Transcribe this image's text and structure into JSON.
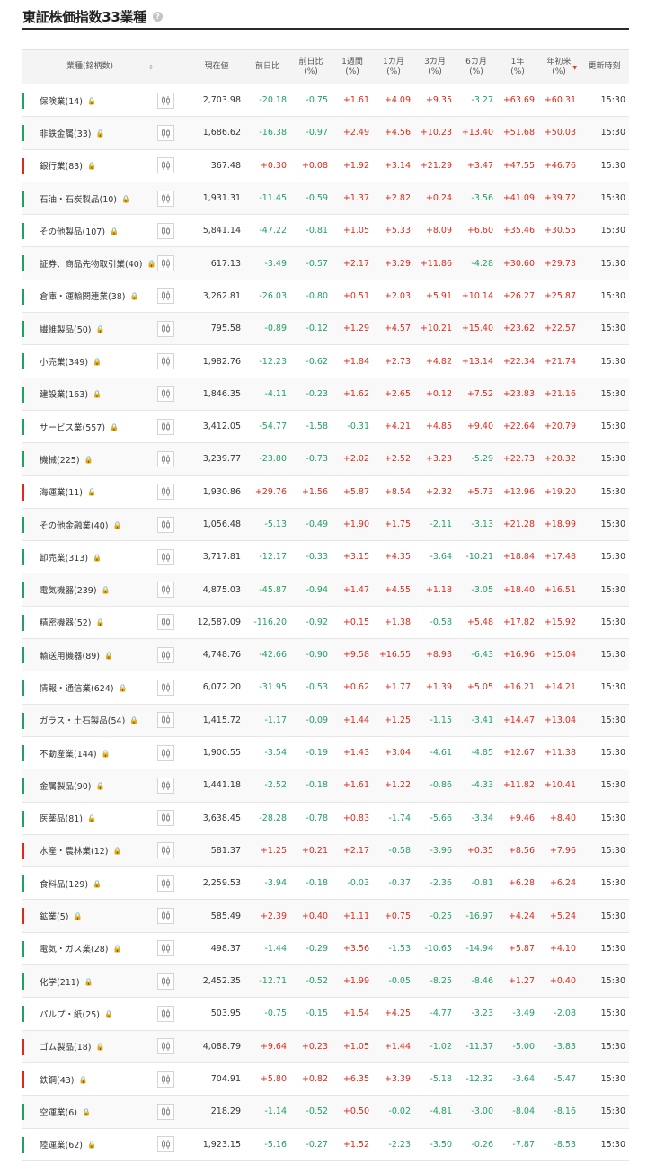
{
  "page_title": "東証株価指数33業種",
  "help_icon": "question-circle-icon",
  "lock_icon": "lock-icon",
  "chart_icon": "candlestick-chart-icon",
  "colors": {
    "up": "#e0281a",
    "down": "#20a162",
    "neutral": "#333333"
  },
  "columns": {
    "name": "業種(銘柄数)",
    "price": "現在値",
    "change": "前日比",
    "change_pct": "前日比\n(%)",
    "w1": "1週間\n(%)",
    "m1": "1カ月\n(%)",
    "m3": "3カ月\n(%)",
    "m6": "6カ月\n(%)",
    "y1": "1年\n(%)",
    "ytd": "年初来\n(%)",
    "time": "更新時刻"
  },
  "sort_icon": "↕",
  "sorted_desc_icon": "▼",
  "rows": [
    {
      "name": "保険業(14)",
      "price": "2,703.98",
      "change": "-20.18",
      "change_pct": "-0.75",
      "w1": "+1.61",
      "m1": "+4.09",
      "m3": "+9.35",
      "m6": "-3.27",
      "y1": "+63.69",
      "ytd": "+60.31",
      "time": "15:30"
    },
    {
      "name": "非鉄金属(33)",
      "price": "1,686.62",
      "change": "-16.38",
      "change_pct": "-0.97",
      "w1": "+2.49",
      "m1": "+4.56",
      "m3": "+10.23",
      "m6": "+13.40",
      "y1": "+51.68",
      "ytd": "+50.03",
      "time": "15:30"
    },
    {
      "name": "銀行業(83)",
      "price": "367.48",
      "change": "+0.30",
      "change_pct": "+0.08",
      "w1": "+1.92",
      "m1": "+3.14",
      "m3": "+21.29",
      "m6": "+3.47",
      "y1": "+47.55",
      "ytd": "+46.76",
      "time": "15:30"
    },
    {
      "name": "石油・石炭製品(10)",
      "price": "1,931.31",
      "change": "-11.45",
      "change_pct": "-0.59",
      "w1": "+1.37",
      "m1": "+2.82",
      "m3": "+0.24",
      "m6": "-3.56",
      "y1": "+41.09",
      "ytd": "+39.72",
      "time": "15:30"
    },
    {
      "name": "その他製品(107)",
      "price": "5,841.14",
      "change": "-47.22",
      "change_pct": "-0.81",
      "w1": "+1.05",
      "m1": "+5.33",
      "m3": "+8.09",
      "m6": "+6.60",
      "y1": "+35.46",
      "ytd": "+30.55",
      "time": "15:30"
    },
    {
      "name": "証券、商品先物取引業(40)",
      "price": "617.13",
      "change": "-3.49",
      "change_pct": "-0.57",
      "w1": "+2.17",
      "m1": "+3.29",
      "m3": "+11.86",
      "m6": "-4.28",
      "y1": "+30.60",
      "ytd": "+29.73",
      "time": "15:30"
    },
    {
      "name": "倉庫・運輸関連業(38)",
      "price": "3,262.81",
      "change": "-26.03",
      "change_pct": "-0.80",
      "w1": "+0.51",
      "m1": "+2.03",
      "m3": "+5.91",
      "m6": "+10.14",
      "y1": "+26.27",
      "ytd": "+25.87",
      "time": "15:30"
    },
    {
      "name": "繊維製品(50)",
      "price": "795.58",
      "change": "-0.89",
      "change_pct": "-0.12",
      "w1": "+1.29",
      "m1": "+4.57",
      "m3": "+10.21",
      "m6": "+15.40",
      "y1": "+23.62",
      "ytd": "+22.57",
      "time": "15:30"
    },
    {
      "name": "小売業(349)",
      "price": "1,982.76",
      "change": "-12.23",
      "change_pct": "-0.62",
      "w1": "+1.84",
      "m1": "+2.73",
      "m3": "+4.82",
      "m6": "+13.14",
      "y1": "+22.34",
      "ytd": "+21.74",
      "time": "15:30"
    },
    {
      "name": "建設業(163)",
      "price": "1,846.35",
      "change": "-4.11",
      "change_pct": "-0.23",
      "w1": "+1.62",
      "m1": "+2.65",
      "m3": "+0.12",
      "m6": "+7.52",
      "y1": "+23.83",
      "ytd": "+21.16",
      "time": "15:30"
    },
    {
      "name": "サービス業(557)",
      "price": "3,412.05",
      "change": "-54.77",
      "change_pct": "-1.58",
      "w1": "-0.31",
      "m1": "+4.21",
      "m3": "+4.85",
      "m6": "+9.40",
      "y1": "+22.64",
      "ytd": "+20.79",
      "time": "15:30"
    },
    {
      "name": "機械(225)",
      "price": "3,239.77",
      "change": "-23.80",
      "change_pct": "-0.73",
      "w1": "+2.02",
      "m1": "+2.52",
      "m3": "+3.23",
      "m6": "-5.29",
      "y1": "+22.73",
      "ytd": "+20.32",
      "time": "15:30"
    },
    {
      "name": "海運業(11)",
      "price": "1,930.86",
      "change": "+29.76",
      "change_pct": "+1.56",
      "w1": "+5.87",
      "m1": "+8.54",
      "m3": "+2.32",
      "m6": "+5.73",
      "y1": "+12.96",
      "ytd": "+19.20",
      "time": "15:30"
    },
    {
      "name": "その他金融業(40)",
      "price": "1,056.48",
      "change": "-5.13",
      "change_pct": "-0.49",
      "w1": "+1.90",
      "m1": "+1.75",
      "m3": "-2.11",
      "m6": "-3.13",
      "y1": "+21.28",
      "ytd": "+18.99",
      "time": "15:30"
    },
    {
      "name": "卸売業(313)",
      "price": "3,717.81",
      "change": "-12.17",
      "change_pct": "-0.33",
      "w1": "+3.15",
      "m1": "+4.35",
      "m3": "-3.64",
      "m6": "-10.21",
      "y1": "+18.84",
      "ytd": "+17.48",
      "time": "15:30"
    },
    {
      "name": "電気機器(239)",
      "price": "4,875.03",
      "change": "-45.87",
      "change_pct": "-0.94",
      "w1": "+1.47",
      "m1": "+4.55",
      "m3": "+1.18",
      "m6": "-3.05",
      "y1": "+18.40",
      "ytd": "+16.51",
      "time": "15:30"
    },
    {
      "name": "精密機器(52)",
      "price": "12,587.09",
      "change": "-116.20",
      "change_pct": "-0.92",
      "w1": "+0.15",
      "m1": "+1.38",
      "m3": "-0.58",
      "m6": "+5.48",
      "y1": "+17.82",
      "ytd": "+15.92",
      "time": "15:30"
    },
    {
      "name": "輸送用機器(89)",
      "price": "4,748.76",
      "change": "-42.66",
      "change_pct": "-0.90",
      "w1": "+9.58",
      "m1": "+16.55",
      "m3": "+8.93",
      "m6": "-6.43",
      "y1": "+16.96",
      "ytd": "+15.04",
      "time": "15:30"
    },
    {
      "name": "情報・通信業(624)",
      "price": "6,072.20",
      "change": "-31.95",
      "change_pct": "-0.53",
      "w1": "+0.62",
      "m1": "+1.77",
      "m3": "+1.39",
      "m6": "+5.05",
      "y1": "+16.21",
      "ytd": "+14.21",
      "time": "15:30"
    },
    {
      "name": "ガラス・土石製品(54)",
      "price": "1,415.72",
      "change": "-1.17",
      "change_pct": "-0.09",
      "w1": "+1.44",
      "m1": "+1.25",
      "m3": "-1.15",
      "m6": "-3.41",
      "y1": "+14.47",
      "ytd": "+13.04",
      "time": "15:30"
    },
    {
      "name": "不動産業(144)",
      "price": "1,900.55",
      "change": "-3.54",
      "change_pct": "-0.19",
      "w1": "+1.43",
      "m1": "+3.04",
      "m3": "-4.61",
      "m6": "-4.85",
      "y1": "+12.67",
      "ytd": "+11.38",
      "time": "15:30"
    },
    {
      "name": "金属製品(90)",
      "price": "1,441.18",
      "change": "-2.52",
      "change_pct": "-0.18",
      "w1": "+1.61",
      "m1": "+1.22",
      "m3": "-0.86",
      "m6": "-4.33",
      "y1": "+11.82",
      "ytd": "+10.41",
      "time": "15:30"
    },
    {
      "name": "医薬品(81)",
      "price": "3,638.45",
      "change": "-28.28",
      "change_pct": "-0.78",
      "w1": "+0.83",
      "m1": "-1.74",
      "m3": "-5.66",
      "m6": "-3.34",
      "y1": "+9.46",
      "ytd": "+8.40",
      "time": "15:30"
    },
    {
      "name": "水産・農林業(12)",
      "price": "581.37",
      "change": "+1.25",
      "change_pct": "+0.21",
      "w1": "+2.17",
      "m1": "-0.58",
      "m3": "-3.96",
      "m6": "+0.35",
      "y1": "+8.56",
      "ytd": "+7.96",
      "time": "15:30"
    },
    {
      "name": "食料品(129)",
      "price": "2,259.53",
      "change": "-3.94",
      "change_pct": "-0.18",
      "w1": "-0.03",
      "m1": "-0.37",
      "m3": "-2.36",
      "m6": "-0.81",
      "y1": "+6.28",
      "ytd": "+6.24",
      "time": "15:30"
    },
    {
      "name": "鉱業(5)",
      "price": "585.49",
      "change": "+2.39",
      "change_pct": "+0.40",
      "w1": "+1.11",
      "m1": "+0.75",
      "m3": "-0.25",
      "m6": "-16.97",
      "y1": "+4.24",
      "ytd": "+5.24",
      "time": "15:30"
    },
    {
      "name": "電気・ガス業(28)",
      "price": "498.37",
      "change": "-1.44",
      "change_pct": "-0.29",
      "w1": "+3.56",
      "m1": "-1.53",
      "m3": "-10.65",
      "m6": "-14.94",
      "y1": "+5.87",
      "ytd": "+4.10",
      "time": "15:30"
    },
    {
      "name": "化学(211)",
      "price": "2,452.35",
      "change": "-12.71",
      "change_pct": "-0.52",
      "w1": "+1.99",
      "m1": "-0.05",
      "m3": "-8.25",
      "m6": "-8.46",
      "y1": "+1.27",
      "ytd": "+0.40",
      "time": "15:30"
    },
    {
      "name": "パルプ・紙(25)",
      "price": "503.95",
      "change": "-0.75",
      "change_pct": "-0.15",
      "w1": "+1.54",
      "m1": "+4.25",
      "m3": "-4.77",
      "m6": "-3.23",
      "y1": "-3.49",
      "ytd": "-2.08",
      "time": "15:30"
    },
    {
      "name": "ゴム製品(18)",
      "price": "4,088.79",
      "change": "+9.64",
      "change_pct": "+0.23",
      "w1": "+1.05",
      "m1": "+1.44",
      "m3": "-1.02",
      "m6": "-11.37",
      "y1": "-5.00",
      "ytd": "-3.83",
      "time": "15:30"
    },
    {
      "name": "鉄鋼(43)",
      "price": "704.91",
      "change": "+5.80",
      "change_pct": "+0.82",
      "w1": "+6.35",
      "m1": "+3.39",
      "m3": "-5.18",
      "m6": "-12.32",
      "y1": "-3.64",
      "ytd": "-5.47",
      "time": "15:30"
    },
    {
      "name": "空運業(6)",
      "price": "218.29",
      "change": "-1.14",
      "change_pct": "-0.52",
      "w1": "+0.50",
      "m1": "-0.02",
      "m3": "-4.81",
      "m6": "-3.00",
      "y1": "-8.04",
      "ytd": "-8.16",
      "time": "15:30"
    },
    {
      "name": "陸運業(62)",
      "price": "1,923.15",
      "change": "-5.16",
      "change_pct": "-0.27",
      "w1": "+1.52",
      "m1": "-2.23",
      "m3": "-3.50",
      "m6": "-0.26",
      "y1": "-7.87",
      "ytd": "-8.53",
      "time": "15:30"
    }
  ]
}
